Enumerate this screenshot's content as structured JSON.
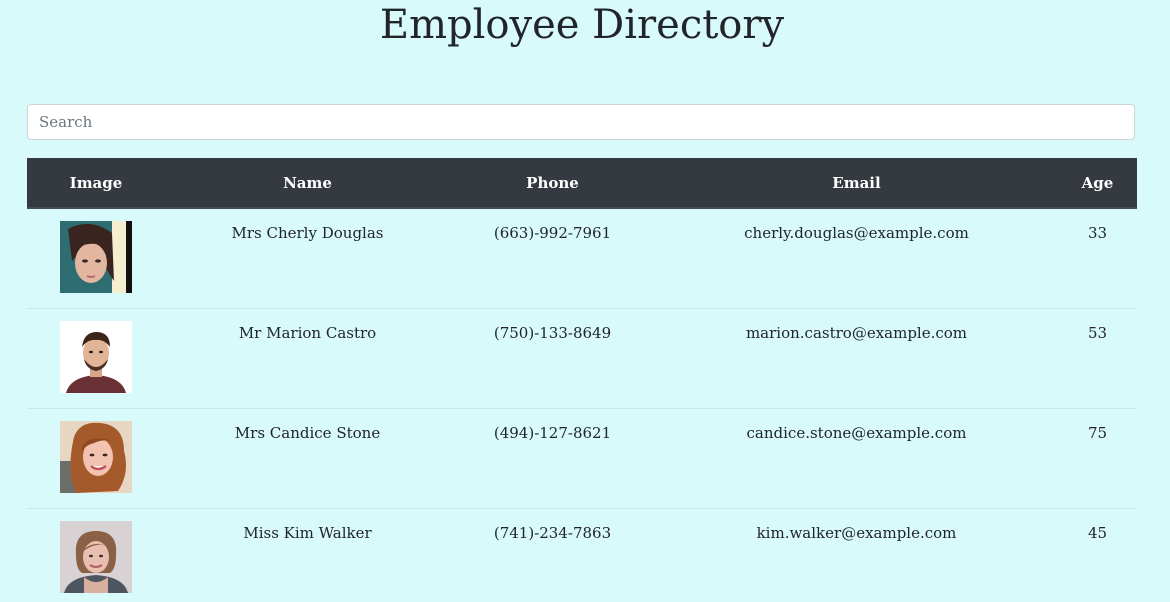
{
  "page": {
    "title": "Employee Directory"
  },
  "search": {
    "placeholder": "Search"
  },
  "table": {
    "headers": {
      "image": "Image",
      "name": "Name",
      "phone": "Phone",
      "email": "Email",
      "age": "Age"
    },
    "rows": [
      {
        "name": "Mrs Cherly Douglas",
        "phone": "(663)-992-7961",
        "email": "cherly.douglas@example.com",
        "age": "33"
      },
      {
        "name": "Mr Marion Castro",
        "phone": "(750)-133-8649",
        "email": "marion.castro@example.com",
        "age": "53"
      },
      {
        "name": "Mrs Candice Stone",
        "phone": "(494)-127-8621",
        "email": "candice.stone@example.com",
        "age": "75"
      },
      {
        "name": "Miss Kim Walker",
        "phone": "(741)-234-7863",
        "email": "kim.walker@example.com",
        "age": "45"
      }
    ]
  },
  "colors": {
    "page_background": "#d8fafa",
    "header_background": "#343a40",
    "header_text": "#ffffff"
  }
}
